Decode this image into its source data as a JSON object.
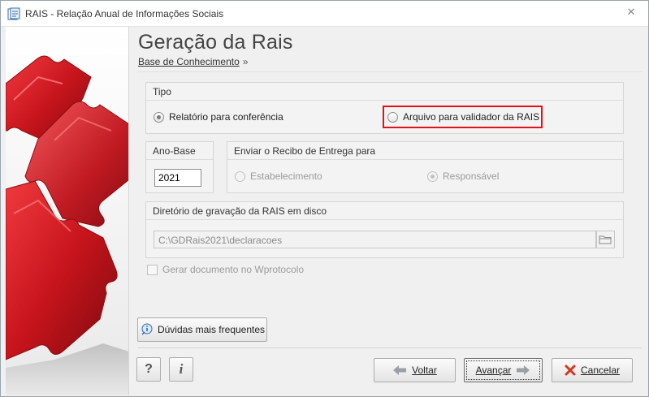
{
  "window": {
    "title": "RAIS - Relação Anual de Informações Sociais",
    "close_symbol": "✕",
    "app_icon": "rais-app-icon"
  },
  "page": {
    "title": "Geração da Rais",
    "breadcrumb_link": "Base de Conhecimento",
    "breadcrumb_sep": "»"
  },
  "tipo": {
    "title": "Tipo",
    "options": [
      {
        "label": "Relatório para conferência",
        "checked": true
      },
      {
        "label": "Arquivo para validador da RAIS",
        "checked": false
      }
    ]
  },
  "ano_base": {
    "title": "Ano-Base",
    "value": "2021"
  },
  "recibo": {
    "title": "Enviar o Recibo de Entrega para",
    "options": [
      {
        "label": "Estabelecimento",
        "checked": false,
        "disabled": true
      },
      {
        "label": "Responsável",
        "checked": true,
        "disabled": true
      }
    ]
  },
  "diretorio": {
    "title": "Diretório de gravação da RAIS em disco",
    "path": "C:\\GDRais2021\\declaracoes",
    "browse_icon": "folder-icon"
  },
  "wprotocolo": {
    "label": "Gerar documento no Wprotocolo",
    "checked": false,
    "disabled": true
  },
  "buttons": {
    "faq": "Dúvidas mais frequentes",
    "help_symbol": "?",
    "info_symbol": "i",
    "back": "Voltar",
    "next": "Avançar",
    "cancel": "Cancelar"
  },
  "colors": {
    "highlight": "#e0131a",
    "puzzle_red": "#c8141c"
  }
}
